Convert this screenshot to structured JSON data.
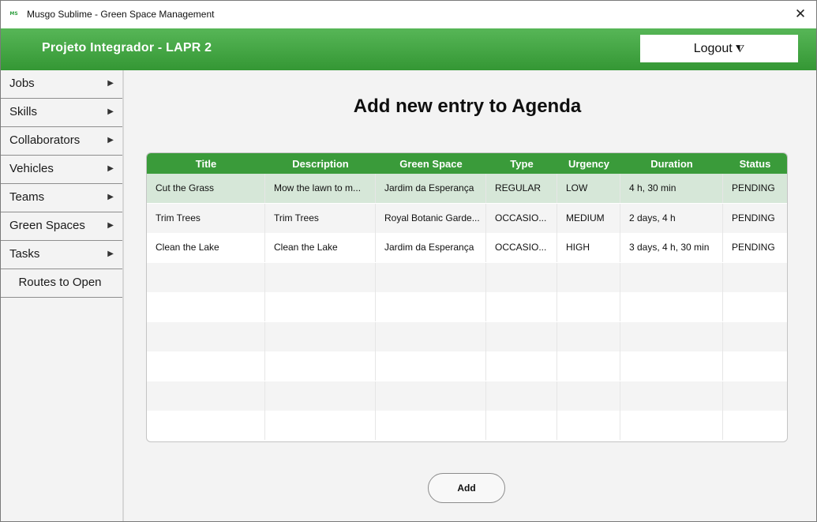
{
  "window": {
    "title": "Musgo Sublime - Green Space Management",
    "icon_text": "MS",
    "close_glyph": "✕"
  },
  "header": {
    "title": "Projeto Integrador - LAPR 2",
    "logout_label": "Logout",
    "logout_icon": "⧨"
  },
  "sidebar": {
    "items": [
      {
        "label": "Jobs",
        "arrow": "▶"
      },
      {
        "label": "Skills",
        "arrow": "▶"
      },
      {
        "label": "Collaborators",
        "arrow": "▶"
      },
      {
        "label": "Vehicles",
        "arrow": "▶"
      },
      {
        "label": "Teams",
        "arrow": "▶"
      },
      {
        "label": "Green Spaces",
        "arrow": "▶"
      },
      {
        "label": "Tasks",
        "arrow": "▶"
      },
      {
        "label": "Routes to Open",
        "arrow": ""
      }
    ]
  },
  "main": {
    "page_title": "Add new entry to Agenda",
    "add_button": "Add"
  },
  "table": {
    "columns": [
      "Title",
      "Description",
      "Green Space",
      "Type",
      "Urgency",
      "Duration",
      "Status"
    ],
    "rows": [
      [
        "Cut the Grass",
        "Mow the lawn to m...",
        "Jardim da Esperança",
        "REGULAR",
        "LOW",
        "4 h, 30 min",
        "PENDING"
      ],
      [
        "Trim Trees",
        "Trim Trees",
        "Royal Botanic Garde...",
        "OCCASIO...",
        "MEDIUM",
        "2 days, 4 h",
        "PENDING"
      ],
      [
        "Clean the Lake",
        "Clean the Lake",
        "Jardim da Esperança",
        "OCCASIO...",
        "HIGH",
        "3 days, 4 h, 30 min",
        "PENDING"
      ],
      [
        "",
        "",
        "",
        "",
        "",
        "",
        ""
      ],
      [
        "",
        "",
        "",
        "",
        "",
        "",
        ""
      ],
      [
        "",
        "",
        "",
        "",
        "",
        "",
        ""
      ],
      [
        "",
        "",
        "",
        "",
        "",
        "",
        ""
      ],
      [
        "",
        "",
        "",
        "",
        "",
        "",
        ""
      ],
      [
        "",
        "",
        "",
        "",
        "",
        "",
        ""
      ]
    ],
    "selected_row": 0
  },
  "colors": {
    "accent": "#3a9b3a",
    "selected_row": "#d6e7d8"
  }
}
